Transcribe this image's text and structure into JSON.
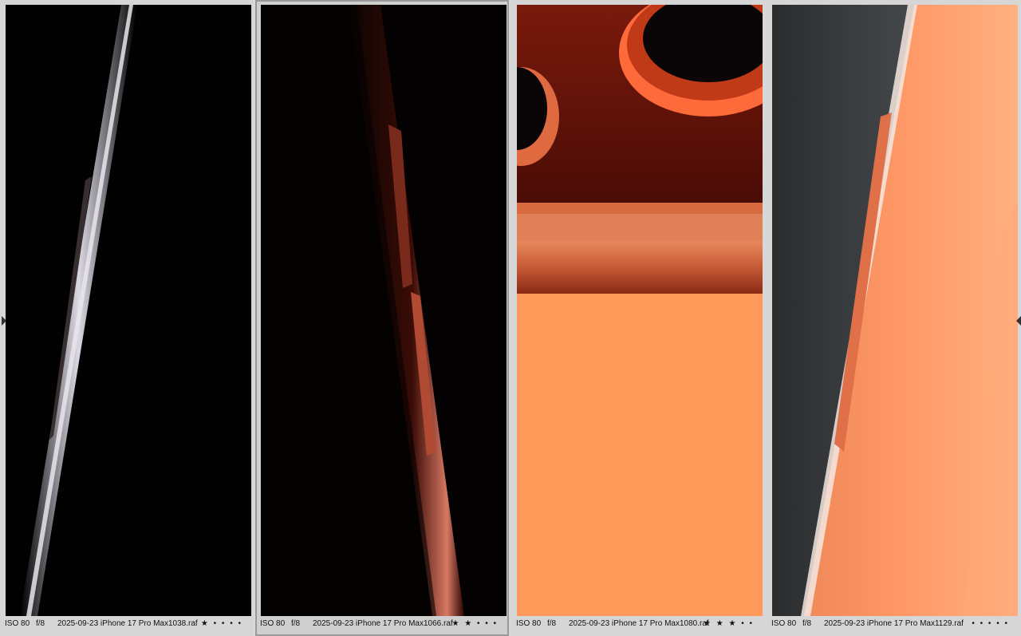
{
  "photos": [
    {
      "iso": "ISO 80",
      "aperture": "f/8",
      "filename": "2025-09-23 iPhone 17 Pro Max1038.raf",
      "rating_text": "★ • • • •",
      "selected": false
    },
    {
      "iso": "ISO 80",
      "aperture": "f/8",
      "filename": "2025-09-23 iPhone 17 Pro Max1066.raf",
      "rating_text": "★ ★ • • •",
      "selected": true
    },
    {
      "iso": "ISO 80",
      "aperture": "f/8",
      "filename": "2025-09-23 iPhone 17 Pro Max1080.raf",
      "rating_text": "★ ★ ★ • •",
      "selected": false
    },
    {
      "iso": "ISO 80",
      "aperture": "f/8",
      "filename": "2025-09-23 iPhone 17 Pro Max1129.raf",
      "rating_text": "• • • • •",
      "selected": false
    }
  ],
  "nav": {
    "prev_icon": "triangle-left-icon",
    "next_icon": "triangle-right-icon"
  },
  "colors": {
    "orange": "#ff8c4a",
    "deep_orange": "#c2401a",
    "background": "#d9d9d9"
  }
}
